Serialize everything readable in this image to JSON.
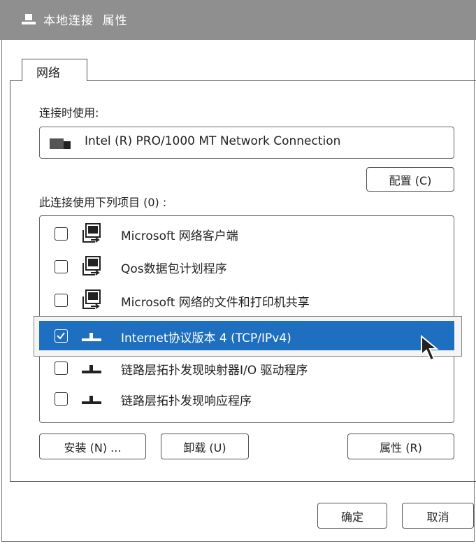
{
  "window": {
    "title": "本地连接  属性"
  },
  "tabs": [
    {
      "label": "网络"
    }
  ],
  "connect_using": {
    "label": "连接时使用:",
    "adapter": "Intel (R) PRO/1000 MT Network Connection",
    "configure_label": "配置 (C)"
  },
  "items": {
    "label": "此连接使用下列项目 (0) :",
    "list": [
      {
        "label": "Microsoft 网络客户端",
        "checked": false,
        "icon": "network-client-icon"
      },
      {
        "label": "Qos数据包计划程序",
        "checked": false,
        "icon": "network-client-icon"
      },
      {
        "label": "Microsoft 网络的文件和打印机共享",
        "checked": false,
        "icon": "network-client-icon"
      },
      {
        "label": "Internet协议版本 4 (TCP/IPv4)",
        "checked": true,
        "selected": true,
        "icon": "protocol-icon"
      },
      {
        "label": "链路层拓扑发现映射器I/O 驱动程序",
        "checked": false,
        "icon": "protocol-icon"
      },
      {
        "label": "链路层拓扑发现响应程序",
        "checked": false,
        "icon": "protocol-icon"
      }
    ]
  },
  "buttons": {
    "install": "安装 (N) ...",
    "uninstall": "卸载 (U)",
    "properties": "属性 (R)",
    "ok": "确定",
    "cancel": "取消"
  },
  "colors": {
    "titlebar": "#8f8f8f",
    "selection": "#1f6fc0"
  }
}
